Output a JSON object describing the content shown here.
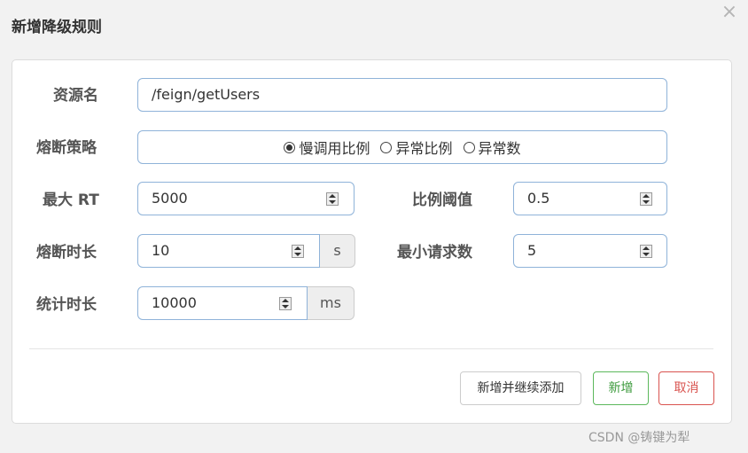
{
  "dialog": {
    "title": "新增降级规则",
    "close_icon": "×"
  },
  "form": {
    "resource": {
      "label": "资源名",
      "value": "/feign/getUsers"
    },
    "strategy": {
      "label": "熔断策略",
      "options": [
        "慢调用比例",
        "异常比例",
        "异常数"
      ],
      "selected": "慢调用比例"
    },
    "max_rt": {
      "label": "最大 RT",
      "value": "5000"
    },
    "ratio_threshold": {
      "label": "比例阈值",
      "value": "0.5"
    },
    "break_duration": {
      "label": "熔断时长",
      "value": "10",
      "unit": "s"
    },
    "min_requests": {
      "label": "最小请求数",
      "value": "5"
    },
    "stat_duration": {
      "label": "统计时长",
      "value": "10000",
      "unit": "ms"
    }
  },
  "footer": {
    "add_continue_label": "新增并继续添加",
    "add_label": "新增",
    "cancel_label": "取消"
  },
  "colors": {
    "input_border": "#8fb3d9",
    "success": "#5cb85c",
    "danger": "#d9534f"
  },
  "watermark": "CSDN @铸键为犁"
}
